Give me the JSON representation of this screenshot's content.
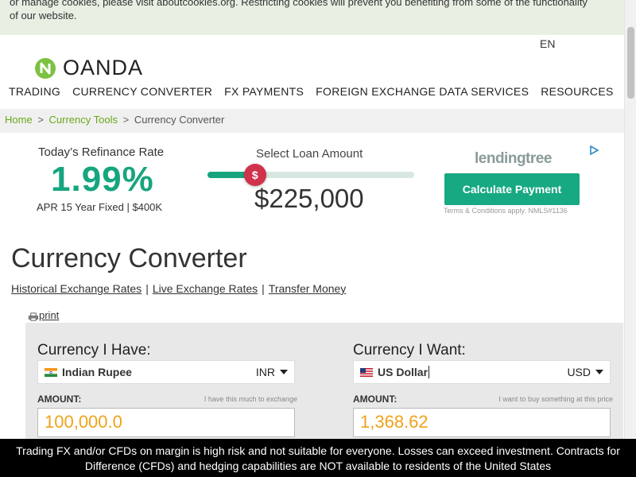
{
  "cookie_banner": {
    "text": "or manage cookies, please visit aboutcookies.org. Restricting cookies will prevent you benefiting from some of the functionality of our website."
  },
  "header": {
    "language": "EN",
    "logo_text": "OANDA",
    "logo_color": "#7cc142",
    "nav": [
      "TRADING",
      "CURRENCY CONVERTER",
      "FX PAYMENTS",
      "FOREIGN EXCHANGE DATA SERVICES",
      "RESOURCES"
    ]
  },
  "breadcrumb": {
    "home": "Home",
    "sep": ">",
    "tools": "Currency Tools",
    "current": "Currency Converter"
  },
  "ad": {
    "rate_title": "Today’s Refinance Rate",
    "rate": "1.99%",
    "rate_sub": "APR 15 Year Fixed | $400K",
    "loan_title": "Select Loan Amount",
    "slider_symbol": "$",
    "slider_level_percent": 23,
    "amount": "$225,000",
    "brand": "lendingtree",
    "cta": "Calculate Payment",
    "terms": "Terms & Conditions apply. NMLS#1136",
    "accent_color": "#16a57f",
    "knob_color": "#d0314b"
  },
  "converter": {
    "title": "Currency Converter",
    "links": [
      "Historical Exchange Rates",
      "Live Exchange Rates",
      "Transfer Money"
    ],
    "print": "print",
    "have": {
      "label": "Currency I Have:",
      "currency_name": "Indian Rupee",
      "currency_code": "INR",
      "flag": "india-flag",
      "amount_label": "AMOUNT:",
      "amount_hint": "I have this much to exchange",
      "amount": "100,000.0"
    },
    "want": {
      "label": "Currency I Want:",
      "currency_name": "US Dollar",
      "currency_code": "USD",
      "flag": "us-flag",
      "amount_label": "AMOUNT:",
      "amount_hint": "I want to buy something at this price",
      "amount": "1,368.62"
    },
    "amount_color": "#f0a319"
  },
  "risk_warning": {
    "text": "Trading FX and/or CFDs on margin is high risk and not suitable for everyone. Losses can exceed investment. Contracts for Difference (CFDs) and hedging capabilities are NOT available to residents of the United States"
  }
}
